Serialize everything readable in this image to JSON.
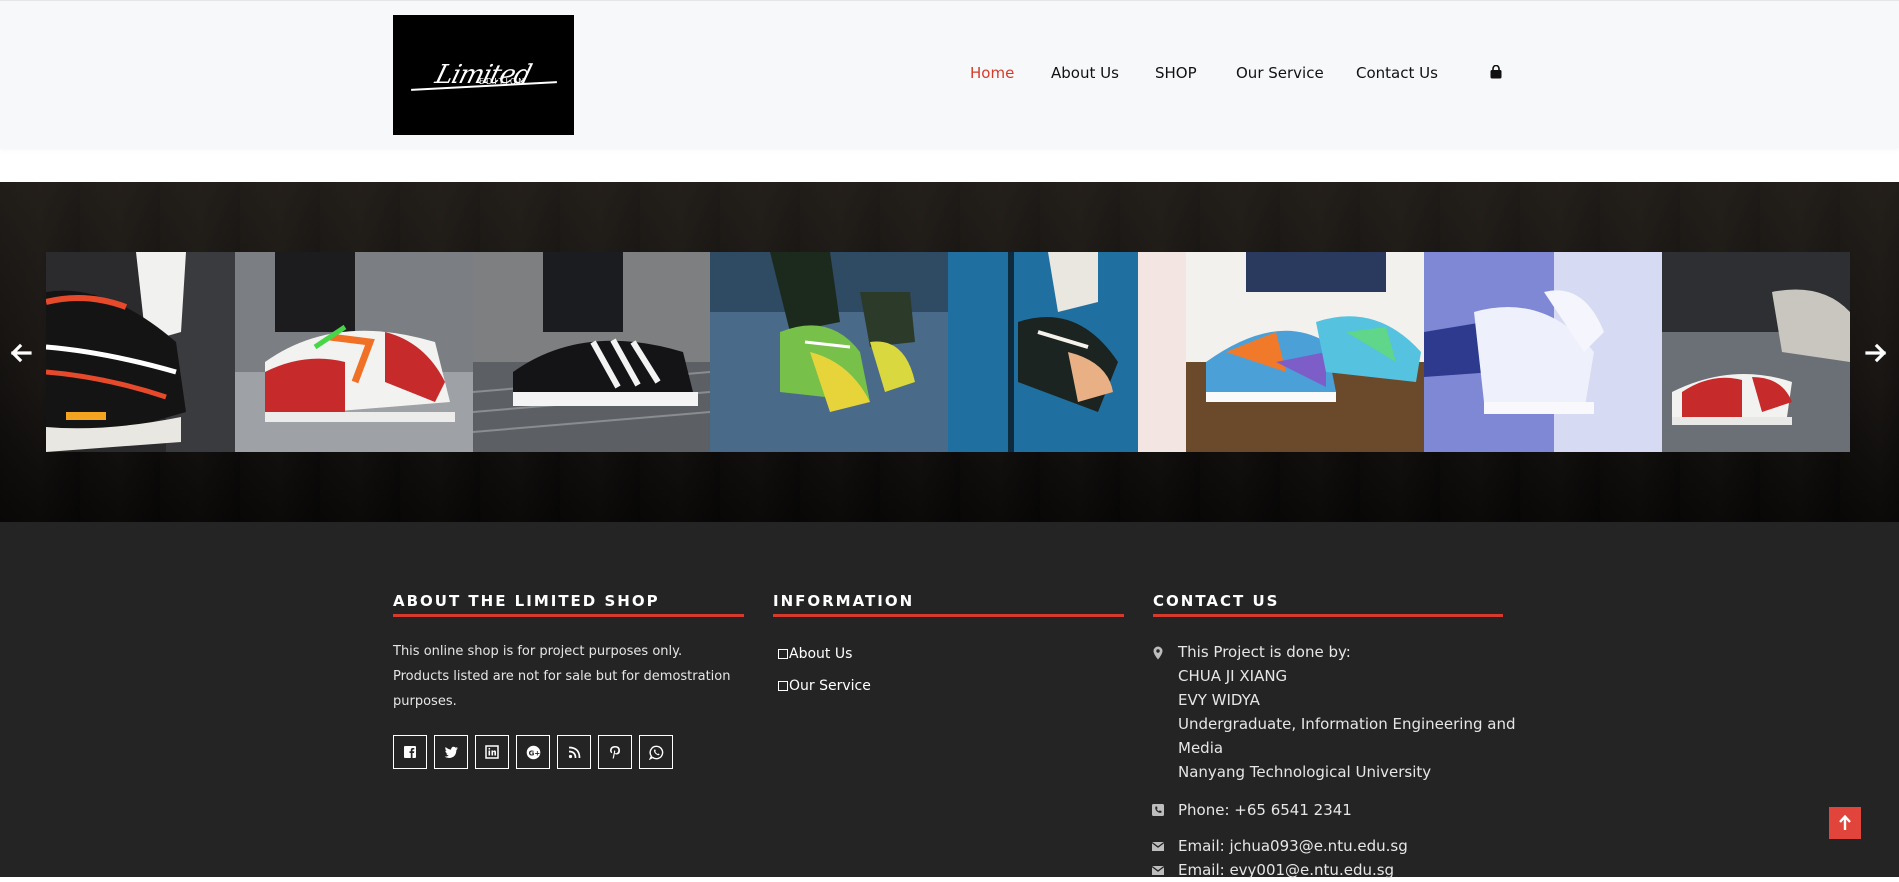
{
  "brand": {
    "logo_text": "Limited",
    "logo_subtext": "EDITION"
  },
  "nav": {
    "items": [
      {
        "label": "Home",
        "active": true
      },
      {
        "label": "About Us",
        "active": false
      },
      {
        "label": "SHOP",
        "active": false
      },
      {
        "label": "Our Service",
        "active": false
      },
      {
        "label": "Contact Us",
        "active": false
      }
    ],
    "cart_icon": "shopping-bag-icon"
  },
  "gallery": {
    "prev_icon": "arrow-left-icon",
    "next_icon": "arrow-right-icon",
    "images": [
      "sneaker-fila-black-orange",
      "sneaker-jordan-red-white",
      "sneaker-adidas-black-stripes",
      "sneaker-green-yellow",
      "sneaker-black-tan",
      "sneaker-puma-multicolor",
      "sneaker-fila-white",
      "sneaker-jordan-red-pair"
    ]
  },
  "footer": {
    "about": {
      "heading": "ABOUT THE LIMITED SHOP",
      "lines": [
        "This online shop is for project purposes only.",
        "Products listed are not for sale but for demostration",
        "purposes."
      ],
      "social_icons": [
        "facebook-icon",
        "twitter-icon",
        "linkedin-icon",
        "google-plus-icon",
        "rss-icon",
        "pinterest-icon",
        "whatsapp-icon"
      ]
    },
    "information": {
      "heading": "INFORMATION",
      "links": [
        "About Us",
        "Our Service"
      ]
    },
    "contact": {
      "heading": "CONTACT US",
      "address_lines": [
        "This Project is done by:",
        "CHUA JI XIANG",
        "EVY WIDYA",
        "Undergraduate, Information Engineering and",
        "Media",
        "Nanyang Technological University"
      ],
      "phone": "Phone: +65 6541 2341",
      "email1": "Email: jchua093@e.ntu.edu.sg",
      "email2": "Email: evy001@e.ntu.edu.sg"
    }
  },
  "back_to_top_icon": "arrow-up-icon",
  "colors": {
    "accent": "#d63a2a",
    "footer_bg": "#242424",
    "header_bg": "#f7f8fa"
  }
}
